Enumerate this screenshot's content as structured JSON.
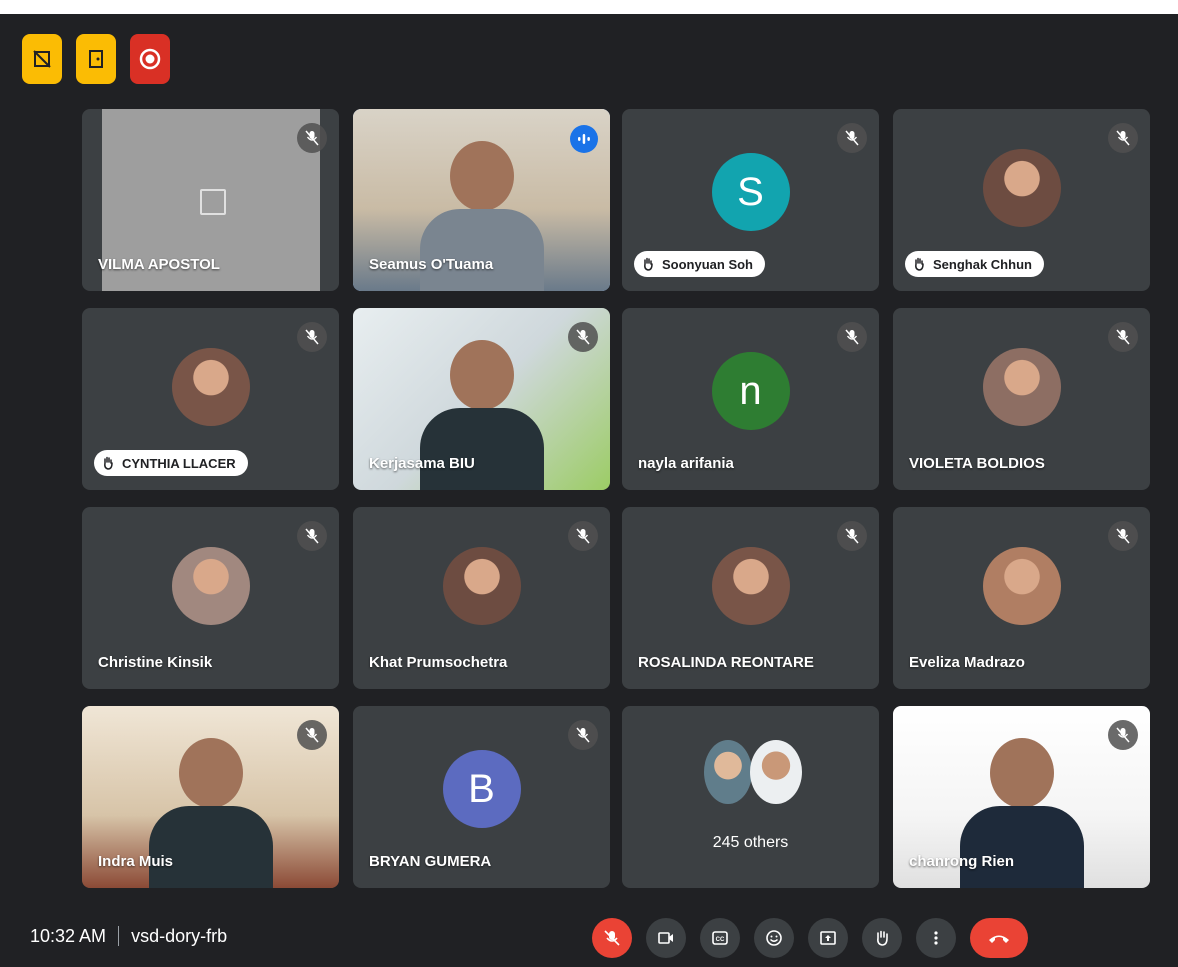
{
  "meeting": {
    "time": "10:32 AM",
    "code": "vsd-dory-frb",
    "colors": {
      "background": "#202124",
      "tile": "#3c4043",
      "accent": "#1a73e8",
      "danger": "#ea4335",
      "highlight": "#fbbc04"
    }
  },
  "top_buttons": [
    "no-activity-icon",
    "door-exit-icon",
    "record-icon"
  ],
  "tiles": [
    {
      "name": "VILMA APOSTOL",
      "type": "screen",
      "muted": true
    },
    {
      "name": "Seamus O'Tuama",
      "type": "video",
      "speaking": true
    },
    {
      "name": "Soonyuan Soh",
      "type": "letter",
      "letter": "S",
      "color": "#12a4af",
      "hand": true,
      "muted": true
    },
    {
      "name": "Senghak Chhun",
      "type": "photo",
      "hand": true,
      "muted": true
    },
    {
      "name": "CYNTHIA LLACER",
      "type": "photo",
      "hand": true,
      "muted": true
    },
    {
      "name": "Kerjasama BIU",
      "type": "video",
      "muted": true
    },
    {
      "name": "nayla arifania",
      "type": "letter",
      "letter": "n",
      "color": "#2e7d32",
      "muted": true
    },
    {
      "name": "VIOLETA BOLDIOS",
      "type": "photo",
      "muted": true
    },
    {
      "name": "Christine Kinsik",
      "type": "photo",
      "muted": true
    },
    {
      "name": "Khat Prumsochetra",
      "type": "photo",
      "muted": true
    },
    {
      "name": "ROSALINDA REONTARE",
      "type": "photo",
      "muted": true
    },
    {
      "name": "Eveliza Madrazo",
      "type": "photo",
      "muted": true
    },
    {
      "name": "Indra Muis",
      "type": "video",
      "muted": true
    },
    {
      "name": "BRYAN GUMERA",
      "type": "letter",
      "letter": "B",
      "color": "#5c6bc0",
      "muted": true
    },
    {
      "name": "245 others",
      "type": "others"
    },
    {
      "name": "chanrong Rien",
      "type": "video",
      "muted": true
    }
  ],
  "controls": [
    "mic-off-icon",
    "camera-icon",
    "captions-icon",
    "emoji-icon",
    "present-icon",
    "raise-hand-icon",
    "more-icon",
    "end-call-icon"
  ]
}
